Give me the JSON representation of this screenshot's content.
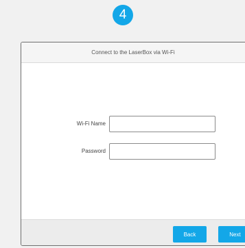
{
  "step": {
    "number": "4",
    "color": "#13a7e8"
  },
  "dialog": {
    "title": "Connect to the LaserBox via Wi-Fi"
  },
  "form": {
    "ssid_label": "Wi-Fi Name",
    "ssid_value": "",
    "password_label": "Password",
    "password_value": ""
  },
  "footer": {
    "back_label": "Back",
    "next_label": "Next"
  },
  "colors": {
    "accent": "#13a7e8",
    "background": "#f1f1f1",
    "dialog_border": "#6f6f6f"
  }
}
